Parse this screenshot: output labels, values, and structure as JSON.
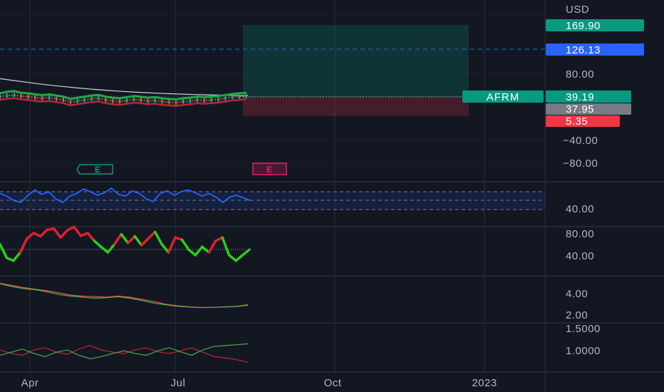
{
  "chart_data": {
    "type": "line",
    "symbol": "AFRM",
    "currency": "USD",
    "x_axis": {
      "ticks": [
        "Apr",
        "Jul",
        "Oct",
        "2023"
      ]
    },
    "panes": [
      {
        "name": "price",
        "y_ticks": [
          "80.00",
          "−40.00",
          "−80.00"
        ],
        "y_top_label": "169.90",
        "last_price": 39.19,
        "series": [
          {
            "values": [
              70.5,
              67.2,
              64.1,
              61.0,
              58.3,
              55.9,
              53.6,
              51.5,
              49.7,
              48.0,
              46.6,
              45.3,
              44.2,
              43.2,
              42.4,
              41.7,
              41.1,
              40.6,
              40.2,
              39.8
            ]
          },
          {
            "values": [
              44,
              47,
              48,
              45,
              44,
              42,
              41,
              42,
              40,
              38,
              34,
              36,
              38,
              40,
              41,
              38,
              36,
              35,
              37,
              39,
              38,
              36,
              37,
              35,
              34,
              33,
              35,
              36,
              38,
              37,
              38,
              39,
              41,
              43,
              44,
              45
            ]
          },
          {
            "values": [
              38,
              40,
              41,
              39,
              38,
              36,
              35,
              36,
              34,
              32,
              28,
              30,
              32,
              34,
              35,
              32,
              30,
              29,
              31,
              33,
              32,
              30,
              31,
              29,
              28,
              27,
              29,
              30,
              32,
              31,
              32,
              33,
              35,
              37,
              38,
              39
            ]
          },
          {
            "values": [
              32,
              34,
              35,
              33,
              32,
              30,
              29,
              30,
              28,
              26,
              22,
              24,
              26,
              28,
              29,
              26,
              24,
              23,
              25,
              27,
              26,
              24,
              25,
              23,
              22,
              21,
              23,
              24,
              26,
              25,
              26,
              27,
              29,
              31,
              32,
              33
            ]
          }
        ],
        "position": {
          "target": 169.9,
          "stop": 5.35,
          "entry": 37.95
        },
        "price_tags": [
          {
            "label": "169.90",
            "value": 169.9,
            "color": "#089981"
          },
          {
            "label": "126.13",
            "value": 126.13,
            "color": "#2962ff"
          },
          {
            "label": "39.19",
            "value": 39.19,
            "color": "#089981"
          },
          {
            "label": "37.95",
            "value": 37.95,
            "color": "#787b86"
          },
          {
            "label": "5.35",
            "value": 5.35,
            "color": "#f23645"
          }
        ],
        "earnings_markers": [
          {
            "label": "E",
            "color": "#089981"
          },
          {
            "label": "E",
            "color": "#e91e63"
          }
        ]
      },
      {
        "name": "rsi",
        "y_ticks": [
          "40.00"
        ],
        "series": [
          {
            "color": "#2962ff",
            "values": [
              58,
              55,
              50,
              48,
              56,
              62,
              57,
              60,
              52,
              48,
              55,
              58,
              63,
              60,
              56,
              59,
              64,
              57,
              55,
              61,
              58,
              52,
              49,
              58,
              61,
              56,
              60,
              62,
              59,
              55,
              58,
              54,
              48,
              54,
              56,
              53,
              50
            ]
          }
        ]
      },
      {
        "name": "stochastic",
        "y_ticks": [
          "80.00",
          "40.00"
        ],
        "series": [
          {
            "values": [
              60,
              35,
              30,
              45,
              70,
              80,
              74,
              86,
              88,
              72,
              85,
              91,
              75,
              80,
              66,
              55,
              45,
              60,
              78,
              62,
              74,
              58,
              70,
              82,
              60,
              45,
              72,
              68,
              50,
              40,
              55,
              45,
              66,
              72,
              40,
              30,
              40,
              50
            ]
          }
        ]
      },
      {
        "name": "lower_band",
        "y_ticks": [
          "4.00",
          "2.00"
        ],
        "series": [
          {
            "color": "#ef5350",
            "values": [
              4.9,
              4.7,
              4.5,
              4.35,
              4.2,
              4.0,
              3.8,
              3.7,
              3.65,
              3.6,
              3.7,
              3.6,
              3.4,
              3.2,
              2.95,
              2.8,
              2.7,
              2.65,
              2.65,
              2.7,
              2.75,
              2.9
            ]
          },
          {
            "color": "#4caf50",
            "values": [
              4.85,
              4.6,
              4.4,
              4.3,
              4.1,
              3.85,
              3.7,
              3.6,
              3.5,
              3.55,
              3.65,
              3.5,
              3.3,
              3.05,
              2.9,
              2.75,
              2.68,
              2.62,
              2.65,
              2.68,
              2.72,
              2.85
            ]
          }
        ]
      },
      {
        "name": "dmi",
        "y_ticks": [
          "1.5000",
          "1.0000"
        ],
        "series": [
          {
            "color": "#b22833",
            "values": [
              1.0,
              0.92,
              0.88,
              1.0,
              1.05,
              0.95,
              0.9,
              1.02,
              1.1,
              1.0,
              0.95,
              0.92,
              1.0,
              1.05,
              0.96,
              0.92,
              0.98,
              1.05,
              0.95,
              0.85,
              0.82,
              0.78,
              0.72
            ]
          },
          {
            "color": "#43a047",
            "values": [
              0.88,
              0.95,
              1.02,
              0.92,
              0.85,
              0.95,
              1.0,
              0.88,
              0.8,
              0.85,
              0.92,
              0.98,
              0.92,
              0.88,
              0.98,
              1.05,
              0.96,
              0.88,
              1.0,
              1.08,
              1.1,
              1.12,
              1.14
            ]
          }
        ]
      }
    ]
  }
}
